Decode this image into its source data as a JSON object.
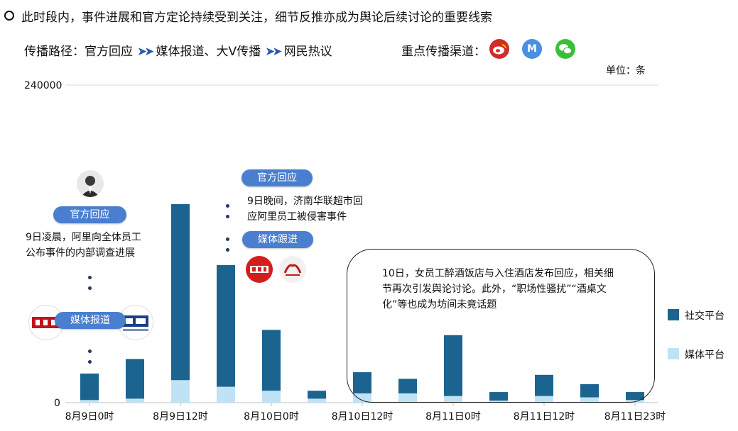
{
  "headline": "此时段内，事件进展和官方定论持续受到关注，细节反推亦成为舆论后续讨论的重要线索",
  "route": {
    "label": "传播路径：",
    "steps": [
      "官方回应",
      "媒体报道、大V传播",
      "网民热议"
    ],
    "arrow": "➤➤"
  },
  "channels": {
    "label": "重点传播渠道：",
    "icons": [
      "weibo-icon",
      "m-icon",
      "wechat-icon"
    ],
    "m_letter": "M"
  },
  "colors": {
    "social": "#1b6490",
    "media": "#bfe3f5",
    "pill": "#4a7fd0",
    "weibo": "#d32a2a",
    "m": "#4a8fe0",
    "wechat": "#3bbf3b"
  },
  "annotations": {
    "pill1": "官方回应",
    "note1": "9日凌晨，阿里向全体员工\n公布事件的内部调查进展",
    "pill2": "媒体报道",
    "pill3": "官方回应",
    "note3": "9日晚间，济南华联超市回\n应阿里员工被侵害事件",
    "pill4": "媒体跟进",
    "callout": "10日，女员工醉酒饭店与入住酒店发布回应，相关细节再次引发舆论讨论。此外，“职场性骚扰”“酒桌文化”等也成为坊间未竟话题"
  },
  "chart_data": {
    "type": "bar",
    "stacked": true,
    "unit": "单位：条",
    "ylim": [
      0,
      240000
    ],
    "y_ticks": [
      0,
      240000
    ],
    "x_tick_labels": [
      "8月9日0时",
      "8月9日12时",
      "8月10日0时",
      "8月10日12时",
      "8月11日0时",
      "8月11日12时",
      "8月11日23时"
    ],
    "series": [
      {
        "name": "媒体平台",
        "values": [
          2000,
          3000,
          17000,
          12000,
          9000,
          3000,
          7000,
          7000,
          5000,
          1500,
          5000,
          4000,
          2000
        ]
      },
      {
        "name": "社交平台",
        "values": [
          20000,
          30000,
          133000,
          92000,
          46000,
          6000,
          16000,
          11000,
          46000,
          6500,
          16000,
          10000,
          6000
        ]
      }
    ],
    "grid": false,
    "legend_position": "right"
  }
}
